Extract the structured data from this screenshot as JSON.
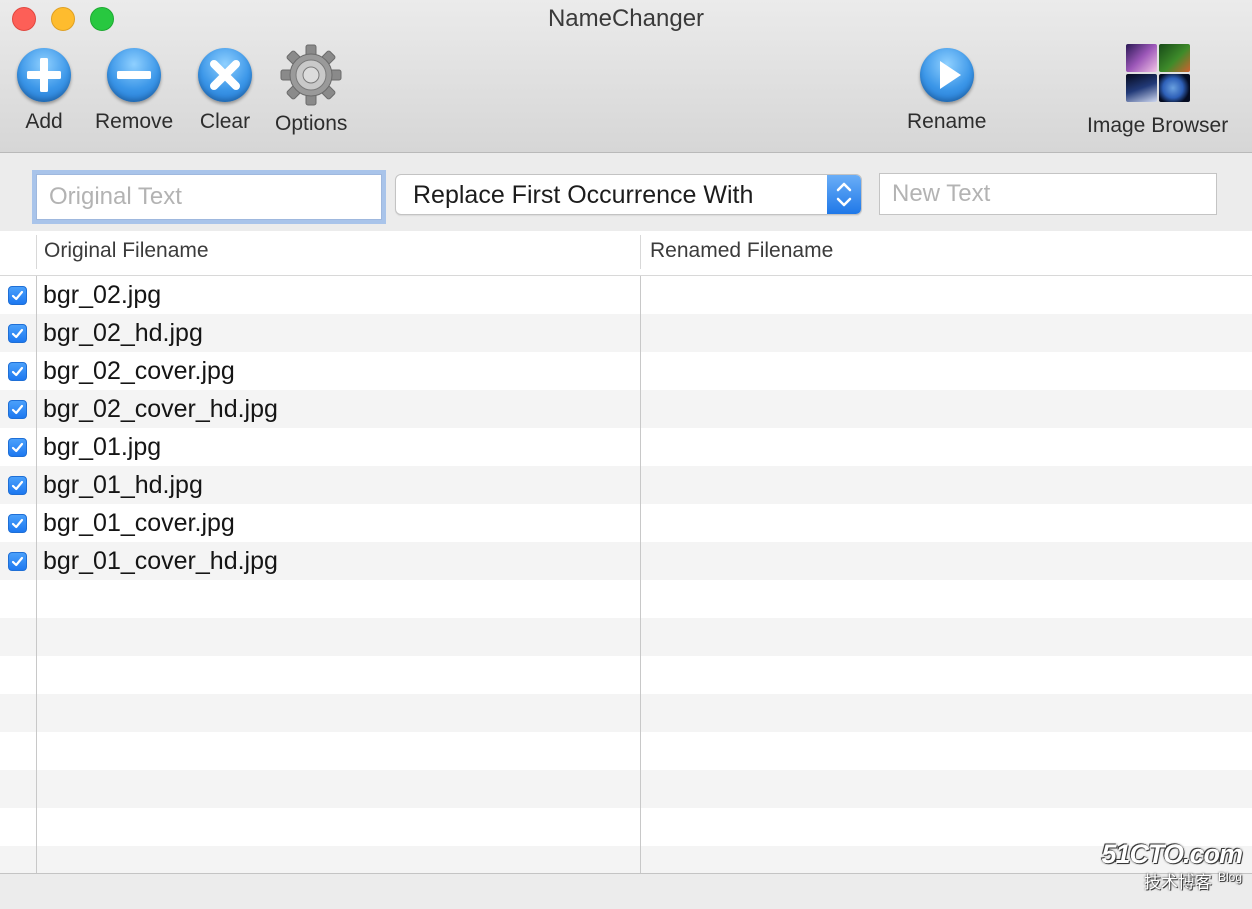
{
  "window": {
    "title": "NameChanger"
  },
  "toolbar": {
    "add_label": "Add",
    "remove_label": "Remove",
    "clear_label": "Clear",
    "options_label": "Options",
    "rename_label": "Rename",
    "image_browser_label": "Image Browser"
  },
  "search": {
    "original_placeholder": "Original Text",
    "mode_selected": "Replace First Occurrence With",
    "new_placeholder": "New Text"
  },
  "table": {
    "columns": {
      "original": "Original Filename",
      "renamed": "Renamed Filename"
    },
    "rows": [
      {
        "name": "bgr_02.jpg",
        "checked": true
      },
      {
        "name": "bgr_02_hd.jpg",
        "checked": true
      },
      {
        "name": "bgr_02_cover.jpg",
        "checked": true
      },
      {
        "name": "bgr_02_cover_hd.jpg",
        "checked": true
      },
      {
        "name": "bgr_01.jpg",
        "checked": true
      },
      {
        "name": "bgr_01_hd.jpg",
        "checked": true
      },
      {
        "name": "bgr_01_cover.jpg",
        "checked": true
      },
      {
        "name": "bgr_01_cover_hd.jpg",
        "checked": true
      }
    ]
  },
  "watermark": {
    "site": "51CTO.com",
    "sub": "技术博客",
    "blog": "Blog"
  },
  "colors": {
    "accent": "#1d78f0",
    "toolbar_icon": "#3b96e8",
    "close": "#fd5f57",
    "minimize": "#febc2e",
    "maximize": "#28c840"
  },
  "icons": {
    "add": "plus-circle-icon",
    "remove": "minus-circle-icon",
    "clear": "x-circle-icon",
    "options": "gear-icon",
    "rename": "play-circle-icon",
    "image_browser": "photo-grid-icon"
  }
}
